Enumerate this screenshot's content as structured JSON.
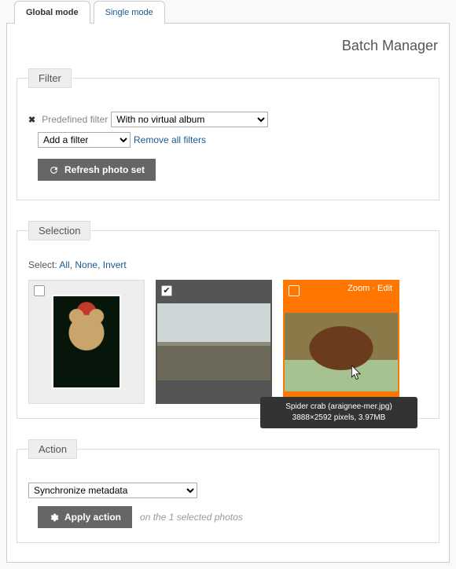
{
  "tabs": {
    "global": "Global mode",
    "single": "Single mode"
  },
  "page_title": "Batch Manager",
  "filter": {
    "legend": "Filter",
    "predefined_label": "Predefined filter",
    "predefined_value": "With no virtual album",
    "add_filter_value": "Add a filter",
    "remove_all": "Remove all filters",
    "refresh_btn": "Refresh photo set"
  },
  "selection": {
    "legend": "Selection",
    "select_label": "Select:",
    "all": "All",
    "none": "None",
    "invert": "Invert",
    "thumbs": [
      {
        "checked": false,
        "state": "normal"
      },
      {
        "checked": true,
        "state": "selected",
        "caption": ""
      },
      {
        "checked": false,
        "state": "hover",
        "zoom": "Zoom",
        "edit": "Edit"
      }
    ],
    "tooltip_line1": "Spider crab (araignee-mer.jpg)",
    "tooltip_line2": "3888×2592 pixels, 3.97MB"
  },
  "action": {
    "legend": "Action",
    "select_value": "Synchronize metadata",
    "apply_btn": "Apply action",
    "note": "on the 1 selected photos"
  }
}
